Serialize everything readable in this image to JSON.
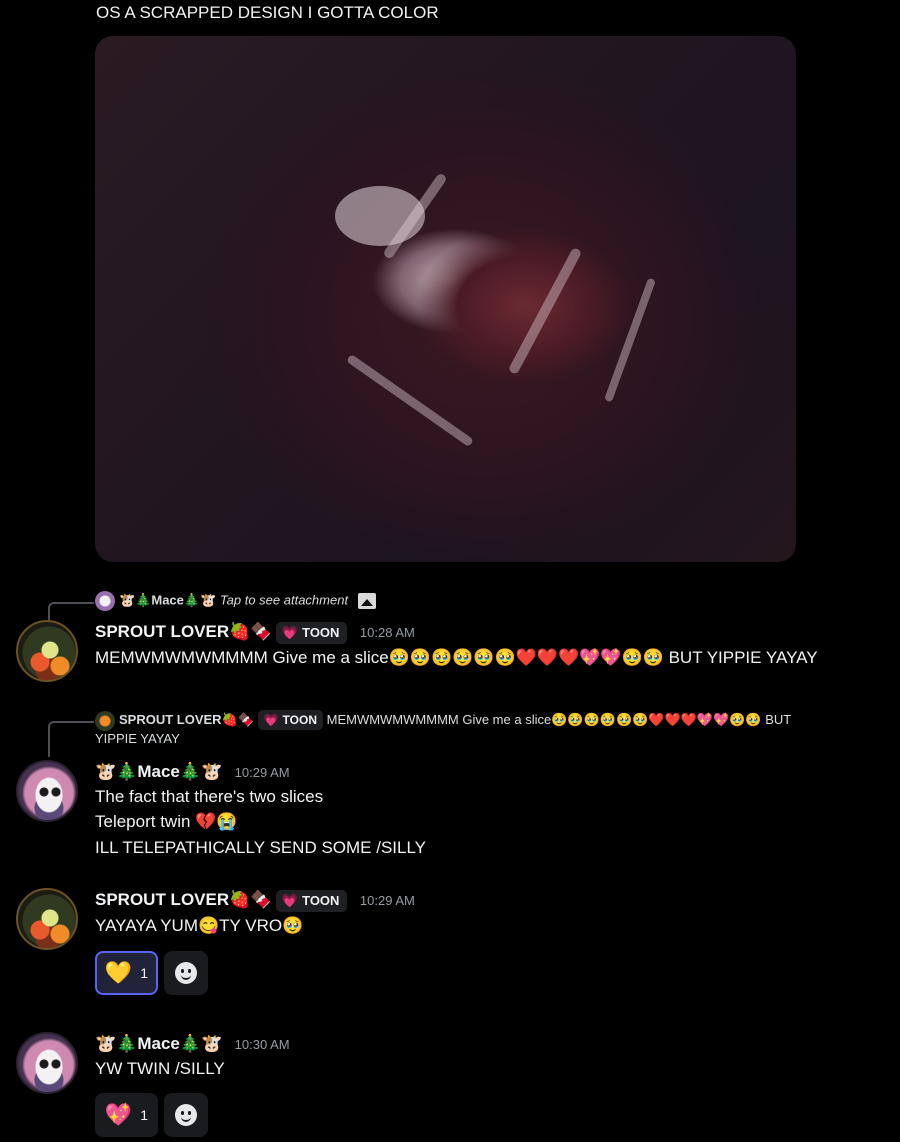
{
  "top_message": {
    "text": "OS A SCRAPPED DESIGN I GOTTA COLOR"
  },
  "icons": {
    "image": "image-icon",
    "add_reaction": "add-reaction-icon"
  },
  "reply_1": {
    "author": "🐮🎄Mace🎄🐮",
    "text": "Tap to see attachment"
  },
  "msg_1": {
    "author": "SPROUT LOVER🍓🍫",
    "tag": "TOON",
    "tag_emoji": "💗",
    "time": "10:28 AM",
    "text": "MEMWMWMWMMMM Give me a slice🥹🥹🥹🥹🥹🥹❤️❤️❤️💖💖🥹🥹 BUT YIPPIE YAYAY"
  },
  "reply_2": {
    "author": "SPROUT LOVER🍓🍫",
    "tag": "TOON",
    "text_line1": "MEMWMWMWMMMM Give me a slice🥹🥹🥹🥹🥹🥹❤️❤️❤️💖💖🥹🥹 BUT",
    "text_line2": "YIPPIE YAYAY"
  },
  "msg_2": {
    "author": "🐮🎄Mace🎄🐮",
    "time": "10:29 AM",
    "lines": [
      "The fact that there's two slices",
      "Teleport twin 💔😭",
      "ILL TELEPATHICALLY SEND SOME /SILLY"
    ]
  },
  "msg_3": {
    "author": "SPROUT LOVER🍓🍫",
    "tag": "TOON",
    "tag_emoji": "💗",
    "time": "10:29 AM",
    "text": "YAYAYA YUM😋TY VRO🥹",
    "reaction": {
      "emoji": "💛",
      "count": "1"
    }
  },
  "msg_4": {
    "author": "🐮🎄Mace🎄🐮",
    "time": "10:30 AM",
    "text": "YW TWIN  /SILLY",
    "reaction": {
      "emoji": "💖",
      "count": "1"
    }
  }
}
